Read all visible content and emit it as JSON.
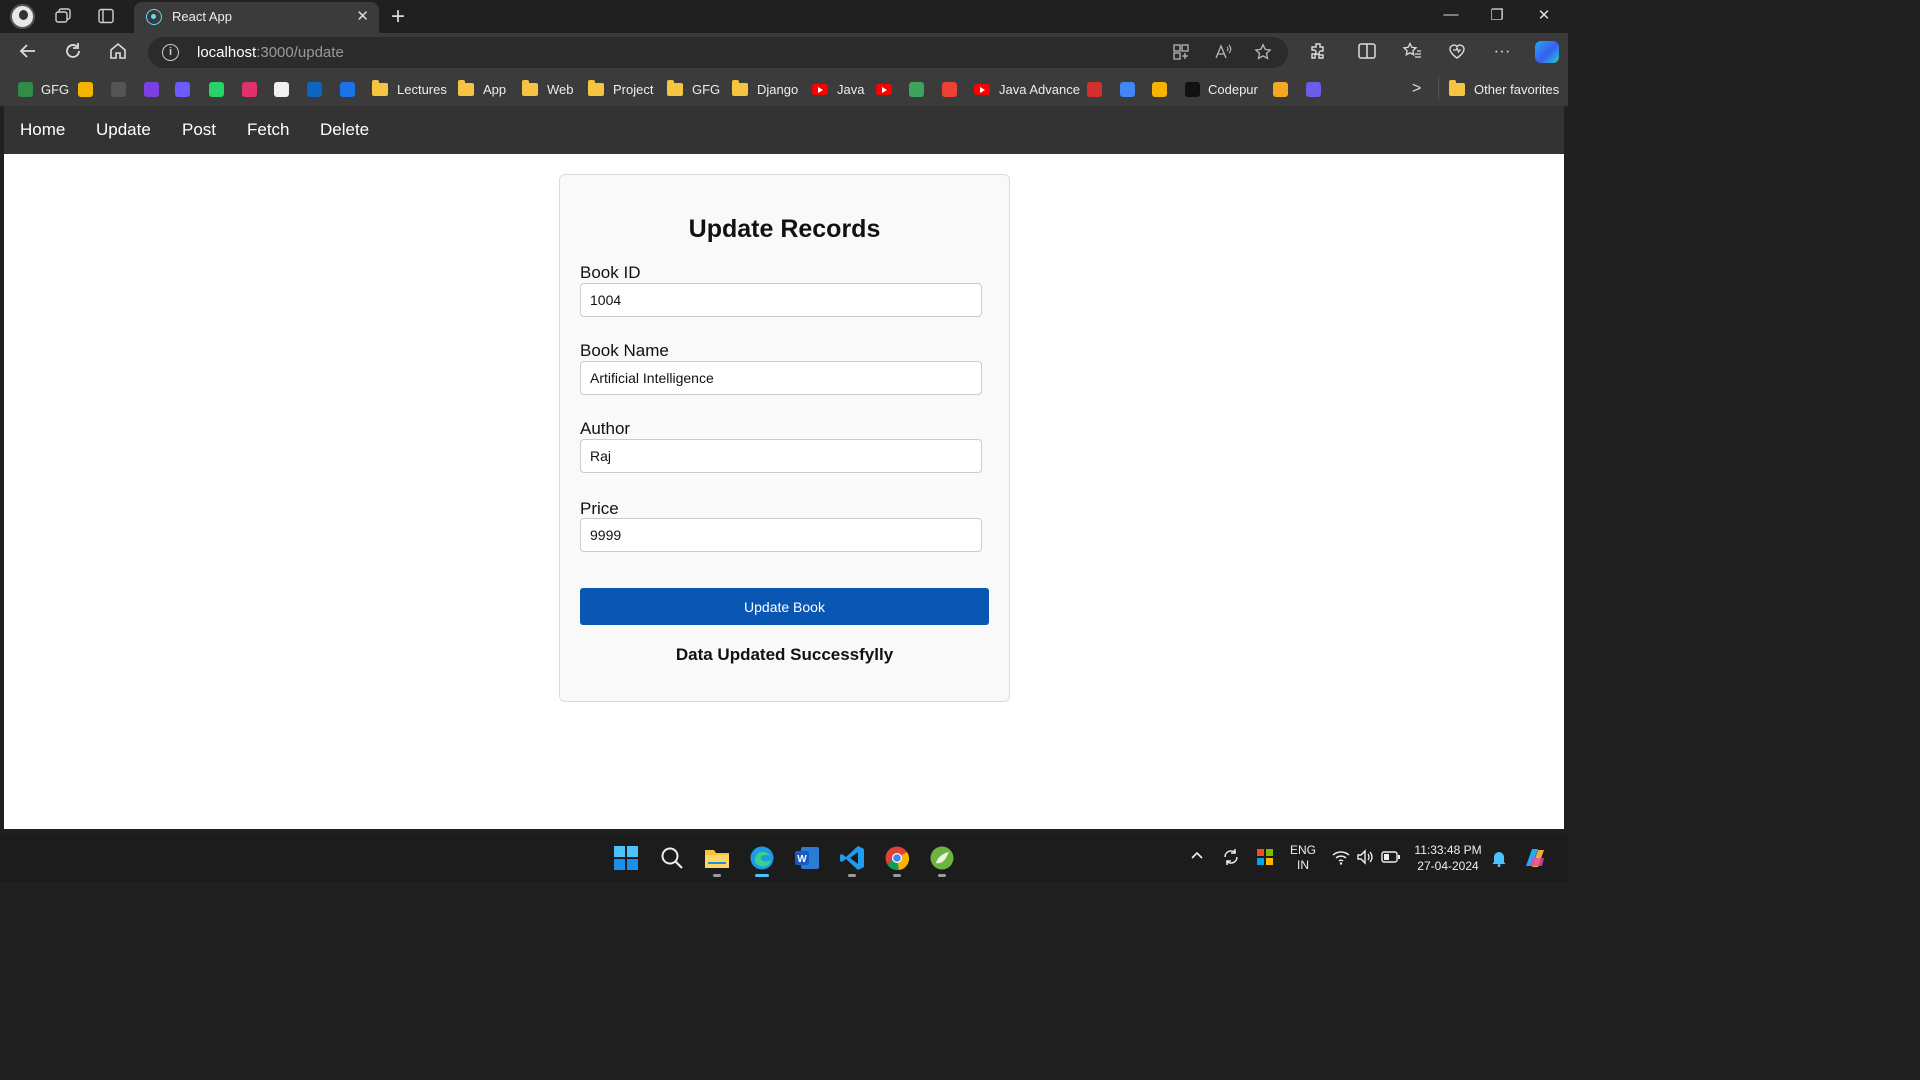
{
  "browser": {
    "tab_title": "React App",
    "tab_close": "✕",
    "new_tab": "+",
    "url_host": "localhost",
    "url_path": ":3000/update",
    "url_info": "i",
    "overflow_chevron": ">",
    "other_favorites": "Other favorites"
  },
  "bookmarks": [
    {
      "label": "GFG",
      "type": "site",
      "icon": "gfg-icon",
      "color": "#2f8d46"
    },
    {
      "label": "",
      "type": "site",
      "icon": "bar-chart-icon",
      "color": "#f4b400"
    },
    {
      "label": "",
      "type": "site",
      "icon": "cc-icon",
      "color": "#555555"
    },
    {
      "label": "",
      "type": "site",
      "icon": "lightning-icon",
      "color": "#7b3fe4"
    },
    {
      "label": "",
      "type": "site",
      "icon": "cloud-icon",
      "color": "#6a5cff"
    },
    {
      "label": "",
      "type": "site",
      "icon": "whatsapp-icon",
      "color": "#25d366"
    },
    {
      "label": "",
      "type": "site",
      "icon": "instagram-icon",
      "color": "#e1306c"
    },
    {
      "label": "",
      "type": "site",
      "icon": "github-icon",
      "color": "#f0f0f0"
    },
    {
      "label": "",
      "type": "site",
      "icon": "linkedin-icon",
      "color": "#0a66c2"
    },
    {
      "label": "",
      "type": "site",
      "icon": "power-icon",
      "color": "#1a73e8"
    },
    {
      "label": "Lectures",
      "type": "folder",
      "icon": "folder-icon"
    },
    {
      "label": "App",
      "type": "folder",
      "icon": "folder-icon"
    },
    {
      "label": "Web",
      "type": "folder",
      "icon": "folder-icon"
    },
    {
      "label": "Project",
      "type": "folder",
      "icon": "folder-icon"
    },
    {
      "label": "GFG",
      "type": "folder",
      "icon": "folder-icon"
    },
    {
      "label": "Django",
      "type": "folder",
      "icon": "folder-icon"
    },
    {
      "label": "Java",
      "type": "youtube",
      "icon": "youtube-icon"
    },
    {
      "label": "",
      "type": "youtube",
      "icon": "youtube-icon"
    },
    {
      "label": "",
      "type": "site",
      "icon": "leaf-icon",
      "color": "#3ba55c"
    },
    {
      "label": "",
      "type": "site",
      "icon": "gmail-icon",
      "color": "#ea4335"
    },
    {
      "label": "Java Advance",
      "type": "youtube",
      "icon": "youtube-icon"
    },
    {
      "label": "",
      "type": "site",
      "icon": "red-app-icon",
      "color": "#d32f2f"
    },
    {
      "label": "",
      "type": "site",
      "icon": "docs-icon",
      "color": "#4285f4"
    },
    {
      "label": "",
      "type": "site",
      "icon": "bar-chart-icon",
      "color": "#f4b400"
    },
    {
      "label": "Codepur",
      "type": "site",
      "icon": "codepen-icon",
      "color": "#111111"
    },
    {
      "label": "",
      "type": "site",
      "icon": "chevron-bookmark-icon",
      "color": "#f5a623"
    },
    {
      "label": "",
      "type": "site",
      "icon": "at-icon",
      "color": "#6c5ce7"
    }
  ],
  "app_nav": [
    "Home",
    "Update",
    "Post",
    "Fetch",
    "Delete"
  ],
  "form": {
    "title": "Update Records",
    "fields": [
      {
        "label": "Book ID",
        "value": "1004"
      },
      {
        "label": "Book Name",
        "value": "Artificial Intelligence"
      },
      {
        "label": "Author",
        "value": "Raj"
      },
      {
        "label": "Price",
        "value": "9999"
      }
    ],
    "submit_label": "Update Book",
    "result_message": "Data Updated Successfylly"
  },
  "taskbar": {
    "language": "ENG",
    "region": "IN",
    "time": "11:33:48 PM",
    "date": "27-04-2024"
  },
  "colors": {
    "app_nav_bg": "#333333",
    "submit_bg": "#0a57b3",
    "browser_chrome": "#3b3b3b"
  }
}
